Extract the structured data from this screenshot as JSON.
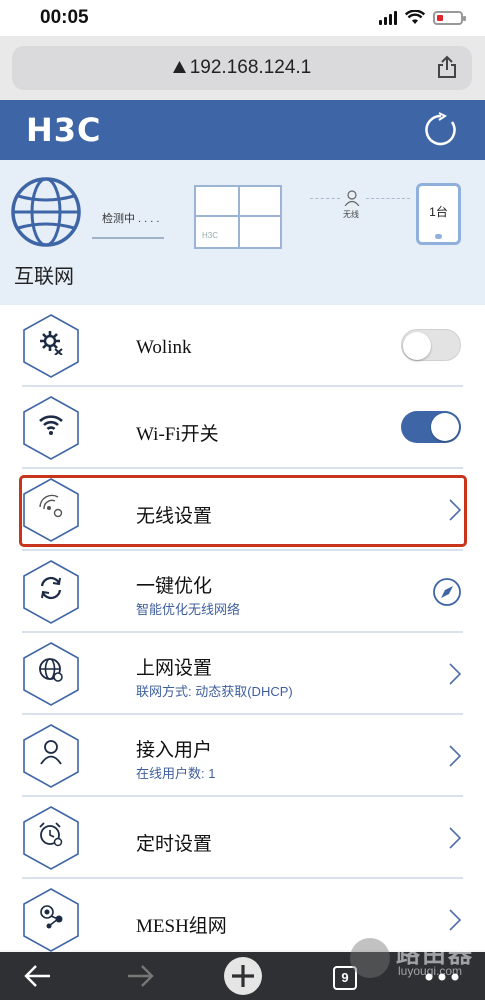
{
  "status_bar": {
    "time": "00:05"
  },
  "browser": {
    "url": "192.168.124.1"
  },
  "header": {
    "logo": "H3C"
  },
  "topology": {
    "internet_label": "互联网",
    "detect_text": "检测中 . . . .",
    "router_brand": "H3C",
    "wireless_label": "无线",
    "device_count": "1台"
  },
  "menu": {
    "items": [
      {
        "title": "Wolink",
        "control": "toggle",
        "state": "off"
      },
      {
        "title": "Wi-Fi开关",
        "control": "toggle",
        "state": "on"
      },
      {
        "title": "无线设置",
        "control": "chevron",
        "highlighted": true
      },
      {
        "title": "一键优化",
        "subtitle": "智能优化无线网络",
        "control": "rocket-icon"
      },
      {
        "title": "上网设置",
        "subtitle": "联网方式: 动态获取(DHCP)",
        "control": "chevron"
      },
      {
        "title": "接入用户",
        "subtitle": "在线用户数: 1",
        "control": "chevron"
      },
      {
        "title": "定时设置",
        "control": "chevron"
      },
      {
        "title": "MESH组网",
        "control": "chevron"
      }
    ]
  },
  "toolbar": {
    "tab_count": "9"
  },
  "watermark": {
    "main": "路由器",
    "sub": "luyouqi.com"
  },
  "colors": {
    "header_blue": "#3e66a6",
    "toggle_on": "#3e66a6",
    "toggle_off": "#e3e3e3",
    "highlight_red": "#c8341c"
  }
}
